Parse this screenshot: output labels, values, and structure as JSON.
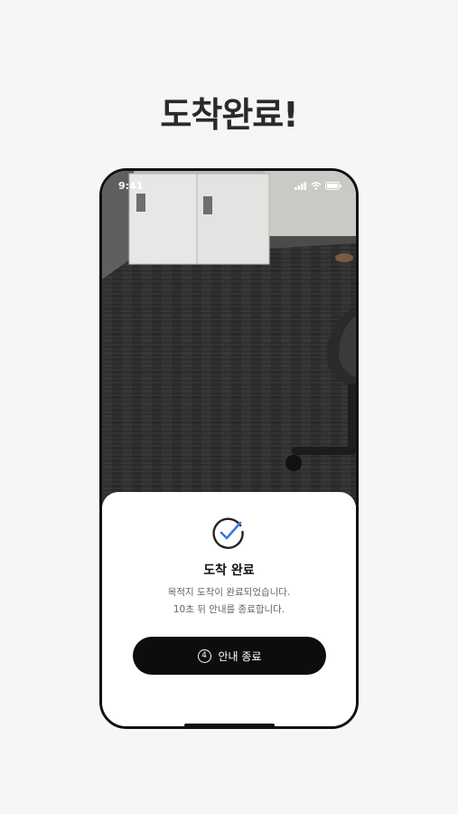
{
  "headline": "도착완료!",
  "status_bar": {
    "time": "9:41",
    "icons": [
      "signal-icon",
      "wifi-icon",
      "battery-icon"
    ]
  },
  "camera_view": {
    "description_icon": "camera-feed"
  },
  "arrival_sheet": {
    "icon": "check-circle-icon",
    "title": "도착 완료",
    "message_line1": "목적지 도착이 완료되었습니다.",
    "message_line2": "10초 뒤 안내를 종료합니다.",
    "end_button": {
      "countdown": "4",
      "label": "안내 종료"
    }
  },
  "colors": {
    "background": "#f6f6f6",
    "check_accent": "#3a78e0",
    "button": "#0d0d0d"
  }
}
